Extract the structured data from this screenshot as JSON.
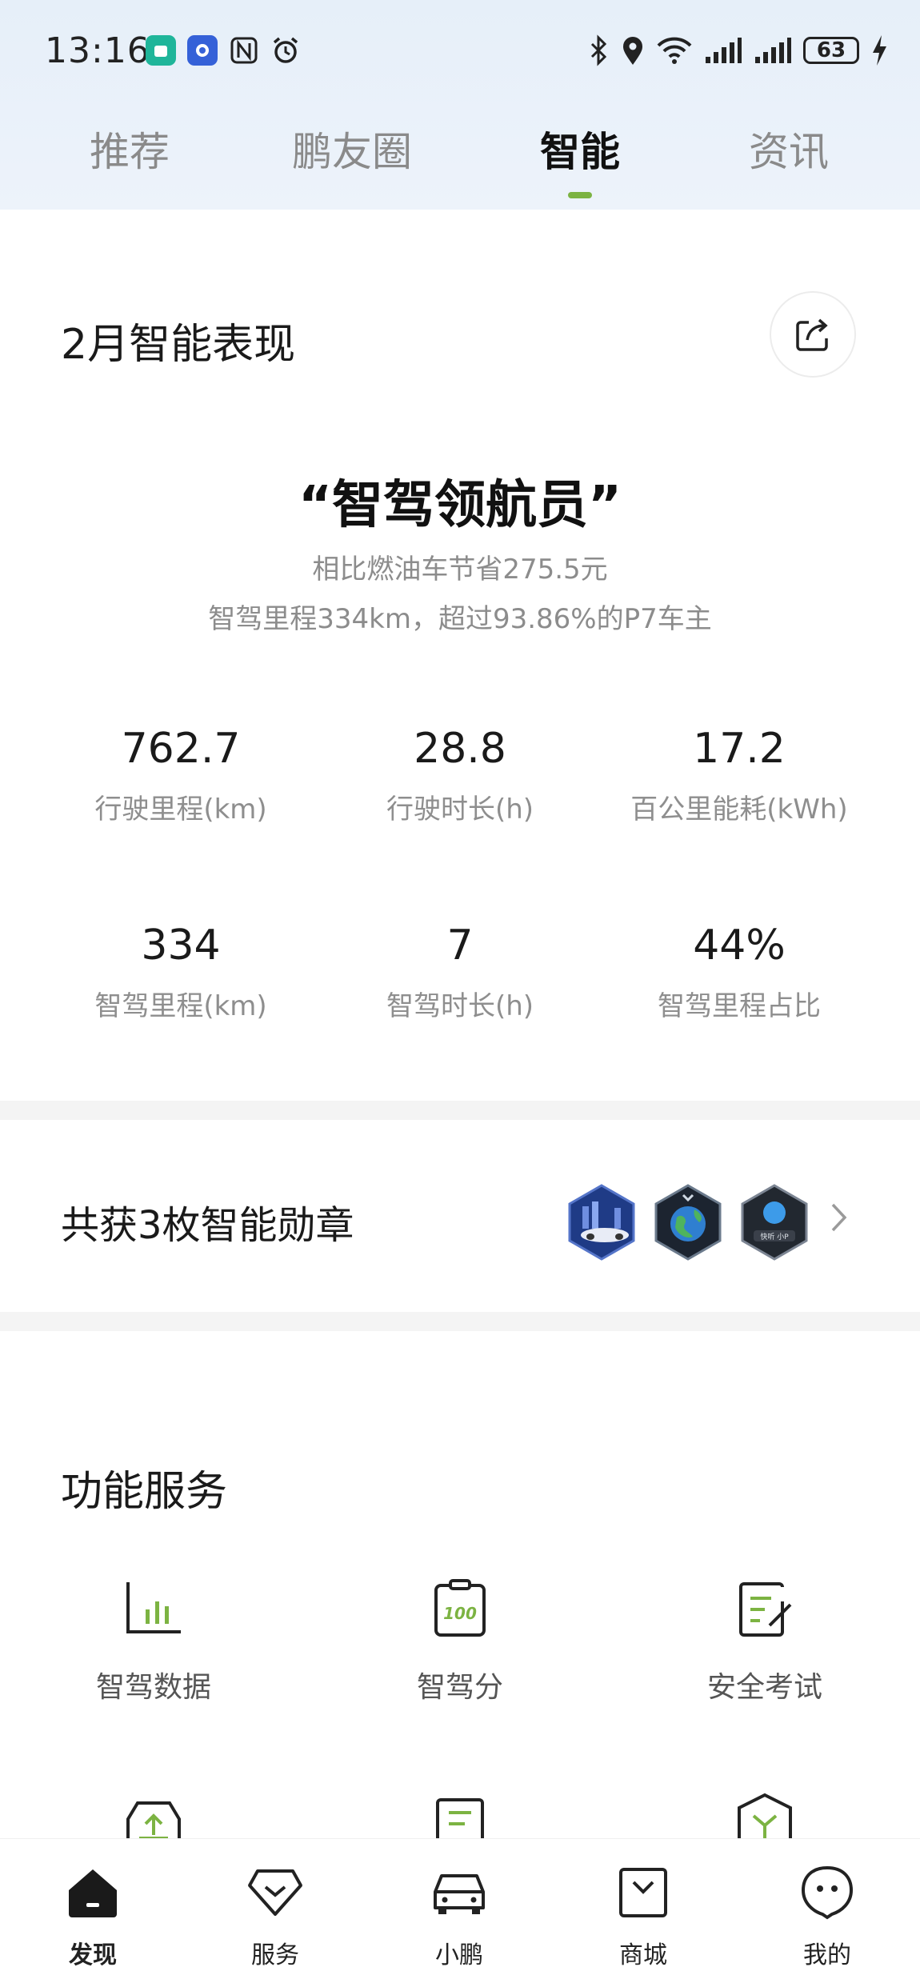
{
  "status_bar": {
    "time": "13:16",
    "battery": "63",
    "icons": [
      "mi-home-icon",
      "app-icon",
      "nfc-icon",
      "alarm-icon",
      "bluetooth-icon",
      "location-icon",
      "wifi-icon",
      "signal-icon",
      "signal-icon",
      "charging-icon"
    ]
  },
  "top_tabs": [
    {
      "label": "推荐",
      "active": false
    },
    {
      "label": "鹏友圈",
      "active": false
    },
    {
      "label": "智能",
      "active": true
    },
    {
      "label": "资讯",
      "active": false
    }
  ],
  "accent_color": "#7cb342",
  "summary": {
    "title": "2月智能表现",
    "badge_title": "“智驾领航员”",
    "line1": "相比燃油车节省275.5元",
    "line2": "智驾里程334km，超过93.86%的P7车主"
  },
  "stats": [
    {
      "value": "762.7",
      "label": "行驶里程(km)"
    },
    {
      "value": "28.8",
      "label": "行驶时长(h)"
    },
    {
      "value": "17.2",
      "label": "百公里能耗(kWh)"
    },
    {
      "value": "334",
      "label": "智驾里程(km)"
    },
    {
      "value": "7",
      "label": "智驾时长(h)"
    },
    {
      "value": "44%",
      "label": "智驾里程占比"
    }
  ],
  "medals": {
    "title": "共获3枚智能勋章",
    "badge_caption": "快听 小P"
  },
  "services": {
    "title": "功能服务",
    "items": [
      {
        "label": "智驾数据",
        "icon": "bar-chart-icon"
      },
      {
        "label": "智驾分",
        "icon": "score-clipboard-icon",
        "icon_text": "100"
      },
      {
        "label": "安全考试",
        "icon": "exam-edit-icon"
      },
      {
        "label": "",
        "icon": "car-upgrade-icon"
      },
      {
        "label": "",
        "icon": "document-icon"
      },
      {
        "label": "",
        "icon": "package-icon"
      }
    ]
  },
  "bottom_nav": [
    {
      "label": "发现",
      "icon": "home-icon",
      "active": true
    },
    {
      "label": "服务",
      "icon": "diamond-icon",
      "active": false
    },
    {
      "label": "小鹏",
      "icon": "car-icon",
      "active": false
    },
    {
      "label": "商城",
      "icon": "shopping-bag-icon",
      "active": false
    },
    {
      "label": "我的",
      "icon": "profile-face-icon",
      "active": false
    }
  ]
}
